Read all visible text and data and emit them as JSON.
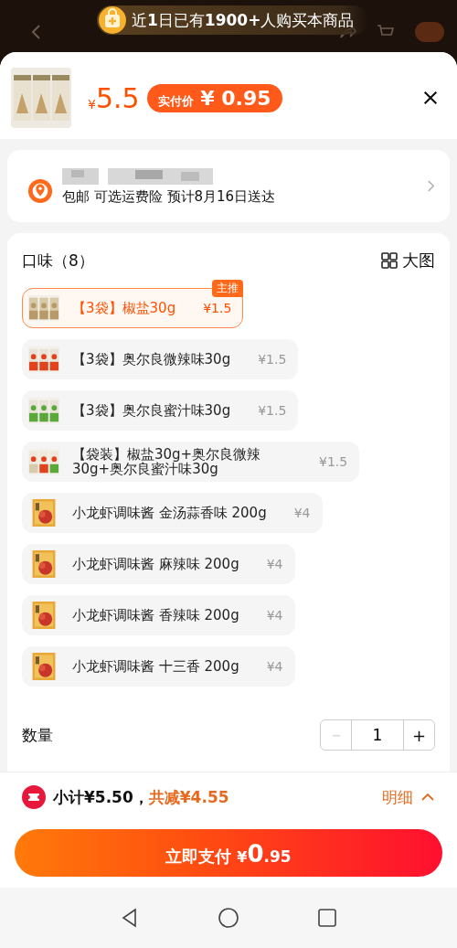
{
  "header": {
    "banner": "近**1**日已有**1900+**人购买本商品"
  },
  "product": {
    "price_currency": "¥",
    "price": "5.5",
    "pay_price_label": "实付价",
    "pay_price": "¥ 0.95"
  },
  "delivery": {
    "text": "包邮 可选运费险 预计8月16日送达"
  },
  "flavors": {
    "title": "口味（8）",
    "view_toggle": "大图",
    "options": [
      {
        "label": "【3袋】椒盐30g",
        "price": "¥1.5",
        "selected": true,
        "kind": "bag",
        "badge": "主推"
      },
      {
        "label": "【3袋】奥尔良微辣味30g",
        "price": "¥1.5",
        "selected": false,
        "kind": "bag-red"
      },
      {
        "label": "【3袋】奥尔良蜜汁味30g",
        "price": "¥1.5",
        "selected": false,
        "kind": "bag-green"
      },
      {
        "label": "【袋装】椒盐30g+奥尔良微辣30g+奥尔良蜜汁味30g",
        "price": "¥1.5",
        "selected": false,
        "kind": "bag-mix"
      },
      {
        "label": "小龙虾调味酱 金汤蒜香味 200g",
        "price": "¥4",
        "selected": false,
        "kind": "sauce"
      },
      {
        "label": "小龙虾调味酱 麻辣味 200g",
        "price": "¥4",
        "selected": false,
        "kind": "sauce"
      },
      {
        "label": "小龙虾调味酱 香辣味 200g",
        "price": "¥4",
        "selected": false,
        "kind": "sauce"
      },
      {
        "label": "小龙虾调味酱 十三香 200g",
        "price": "¥4",
        "selected": false,
        "kind": "sauce"
      }
    ]
  },
  "quantity": {
    "label": "数量",
    "minus": "－",
    "value": "1",
    "plus": "+",
    "minus_disabled": true
  },
  "summary": {
    "subtotal": "小计¥5.50，",
    "discount": "共减¥4.55",
    "details": "明细"
  },
  "pay_button": {
    "label": "立即支付",
    "currency": "¥",
    "integer": "0",
    "decimal": ".95"
  }
}
